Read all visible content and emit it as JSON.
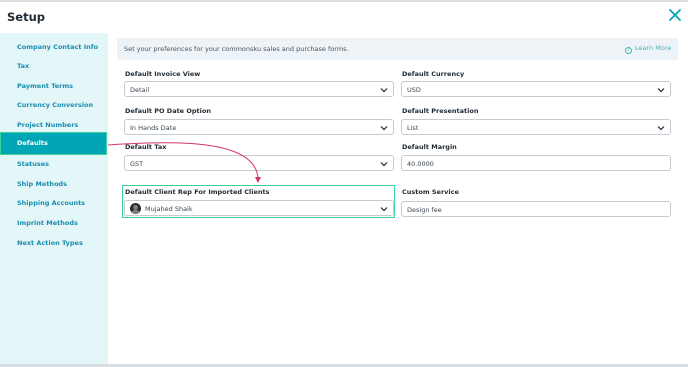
{
  "header": {
    "title": "Setup",
    "close_icon": "close-icon"
  },
  "sidebar": {
    "items": [
      {
        "label": "Company Contact Info"
      },
      {
        "label": "Tax"
      },
      {
        "label": "Payment Terms"
      },
      {
        "label": "Currency Conversion"
      },
      {
        "label": "Project Numbers"
      },
      {
        "label": "Defaults",
        "active": true
      },
      {
        "label": "Statuses"
      },
      {
        "label": "Ship Methods"
      },
      {
        "label": "Shipping Accounts"
      },
      {
        "label": "Imprint Methods"
      },
      {
        "label": "Next Action Types"
      }
    ]
  },
  "banner": {
    "text": "Set your preferences for your commonsku sales and purchase forms.",
    "learn_more": "Learn More"
  },
  "form": {
    "default_invoice_view": {
      "label": "Default Invoice View",
      "value": "Detail"
    },
    "default_currency": {
      "label": "Default Currency",
      "value": "USD"
    },
    "default_po_date_option": {
      "label": "Default PO Date Option",
      "value": "In Hands Date"
    },
    "default_presentation": {
      "label": "Default Presentation",
      "value": "List"
    },
    "default_tax": {
      "label": "Default Tax",
      "value": "GST"
    },
    "default_margin": {
      "label": "Default Margin",
      "value": "40.0000"
    },
    "default_client_rep": {
      "label": "Default Client Rep For Imported Clients",
      "value": "Mujahed Shaik"
    },
    "custom_service": {
      "label": "Custom Service",
      "value": "Design fee"
    }
  },
  "colors": {
    "accent": "#00a6b6",
    "highlight": "#3fcf9a",
    "annotation_arrow": "#d6336c",
    "sidebar_bg": "#e3f6f8",
    "sidebar_link": "#1a8db0"
  }
}
